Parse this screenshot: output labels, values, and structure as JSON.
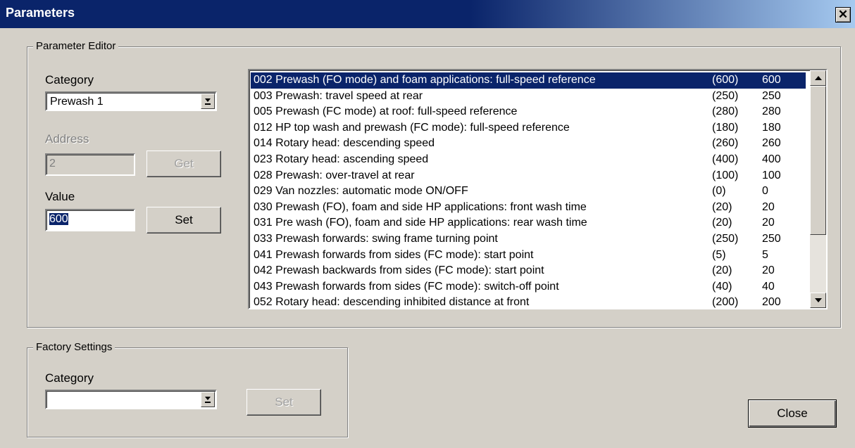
{
  "window": {
    "title": "Parameters",
    "close_glyph": "✕"
  },
  "parameter_editor": {
    "legend": "Parameter Editor",
    "category_label": "Category",
    "category_value": "Prewash 1",
    "address_label": "Address",
    "address_value": "2",
    "get_button": "Get",
    "value_label": "Value",
    "value_text": "600",
    "set_button": "Set",
    "parameters": [
      {
        "desc": "002 Prewash (FO mode) and foam applications: full-speed reference",
        "default": "(600)",
        "value": "600",
        "selected": true
      },
      {
        "desc": "003 Prewash: travel speed  at rear",
        "default": "(250)",
        "value": "250"
      },
      {
        "desc": "005 Prewash (FC mode) at roof: full-speed reference",
        "default": "(280)",
        "value": "280"
      },
      {
        "desc": "012 HP top wash and prewash (FC mode): full-speed reference",
        "default": "(180)",
        "value": "180"
      },
      {
        "desc": "014 Rotary head: descending speed",
        "default": "(260)",
        "value": "260"
      },
      {
        "desc": "023 Rotary head: ascending speed",
        "default": "(400)",
        "value": "400"
      },
      {
        "desc": "028 Prewash: over-travel at rear",
        "default": "(100)",
        "value": "100"
      },
      {
        "desc": "029 Van nozzles: automatic mode ON/OFF",
        "default": "(0)",
        "value": "0"
      },
      {
        "desc": "030 Prewash (FO), foam and side HP applications: front wash time",
        "default": "(20)",
        "value": "20"
      },
      {
        "desc": "031 Pre wash (FO), foam and side HP applications: rear wash time",
        "default": "(20)",
        "value": "20"
      },
      {
        "desc": "033 Prewash forwards: swing frame turning point",
        "default": "(250)",
        "value": "250"
      },
      {
        "desc": "041 Prewash forwards from sides (FC mode): start point",
        "default": "(5)",
        "value": "5"
      },
      {
        "desc": "042 Prewash backwards from sides (FC mode): start point",
        "default": "(20)",
        "value": "20"
      },
      {
        "desc": "043 Prewash forwards from sides (FC mode): switch-off point",
        "default": "(40)",
        "value": "40"
      },
      {
        "desc": "052 Rotary head: descending inhibited distance at front",
        "default": "(200)",
        "value": "200"
      }
    ]
  },
  "factory_settings": {
    "legend": "Factory Settings",
    "category_label": "Category",
    "category_value": "",
    "set_button": "Set"
  },
  "close_button": "Close"
}
